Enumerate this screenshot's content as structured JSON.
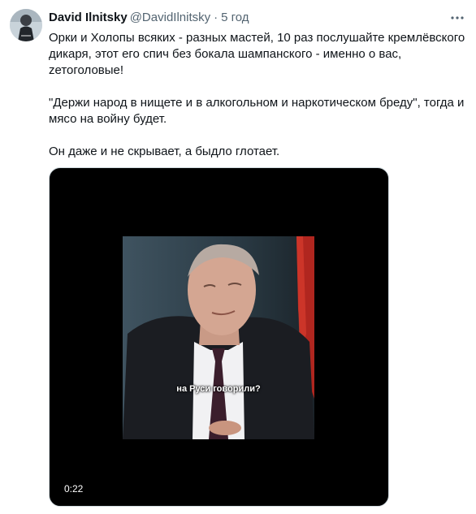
{
  "author": {
    "display_name": "David Ilnitsky",
    "handle": "@DavidIlnitsky",
    "separator": "·",
    "timestamp": "5 год"
  },
  "tweet": {
    "paragraphs": [
      "Орки и Холопы всяких - разных мастей, 10 раз послушайте кремлёвского дикаря, этот его спич без бокала шампанского - именно о вас, zетоголовые!",
      "\"Держи народ в нищете и в алкогольном и наркотическом бреду\", тогда и мясо на войну будет.",
      "Он даже и не скрывает, а быдло глотает."
    ]
  },
  "media": {
    "caption": "на Руси говорили?",
    "duration": "0:22"
  },
  "icons": {
    "more": "more-dots-icon"
  },
  "colors": {
    "text": "#0f1419",
    "secondary": "#536471",
    "border": "#cfd9de",
    "video_bg": "#000000"
  }
}
